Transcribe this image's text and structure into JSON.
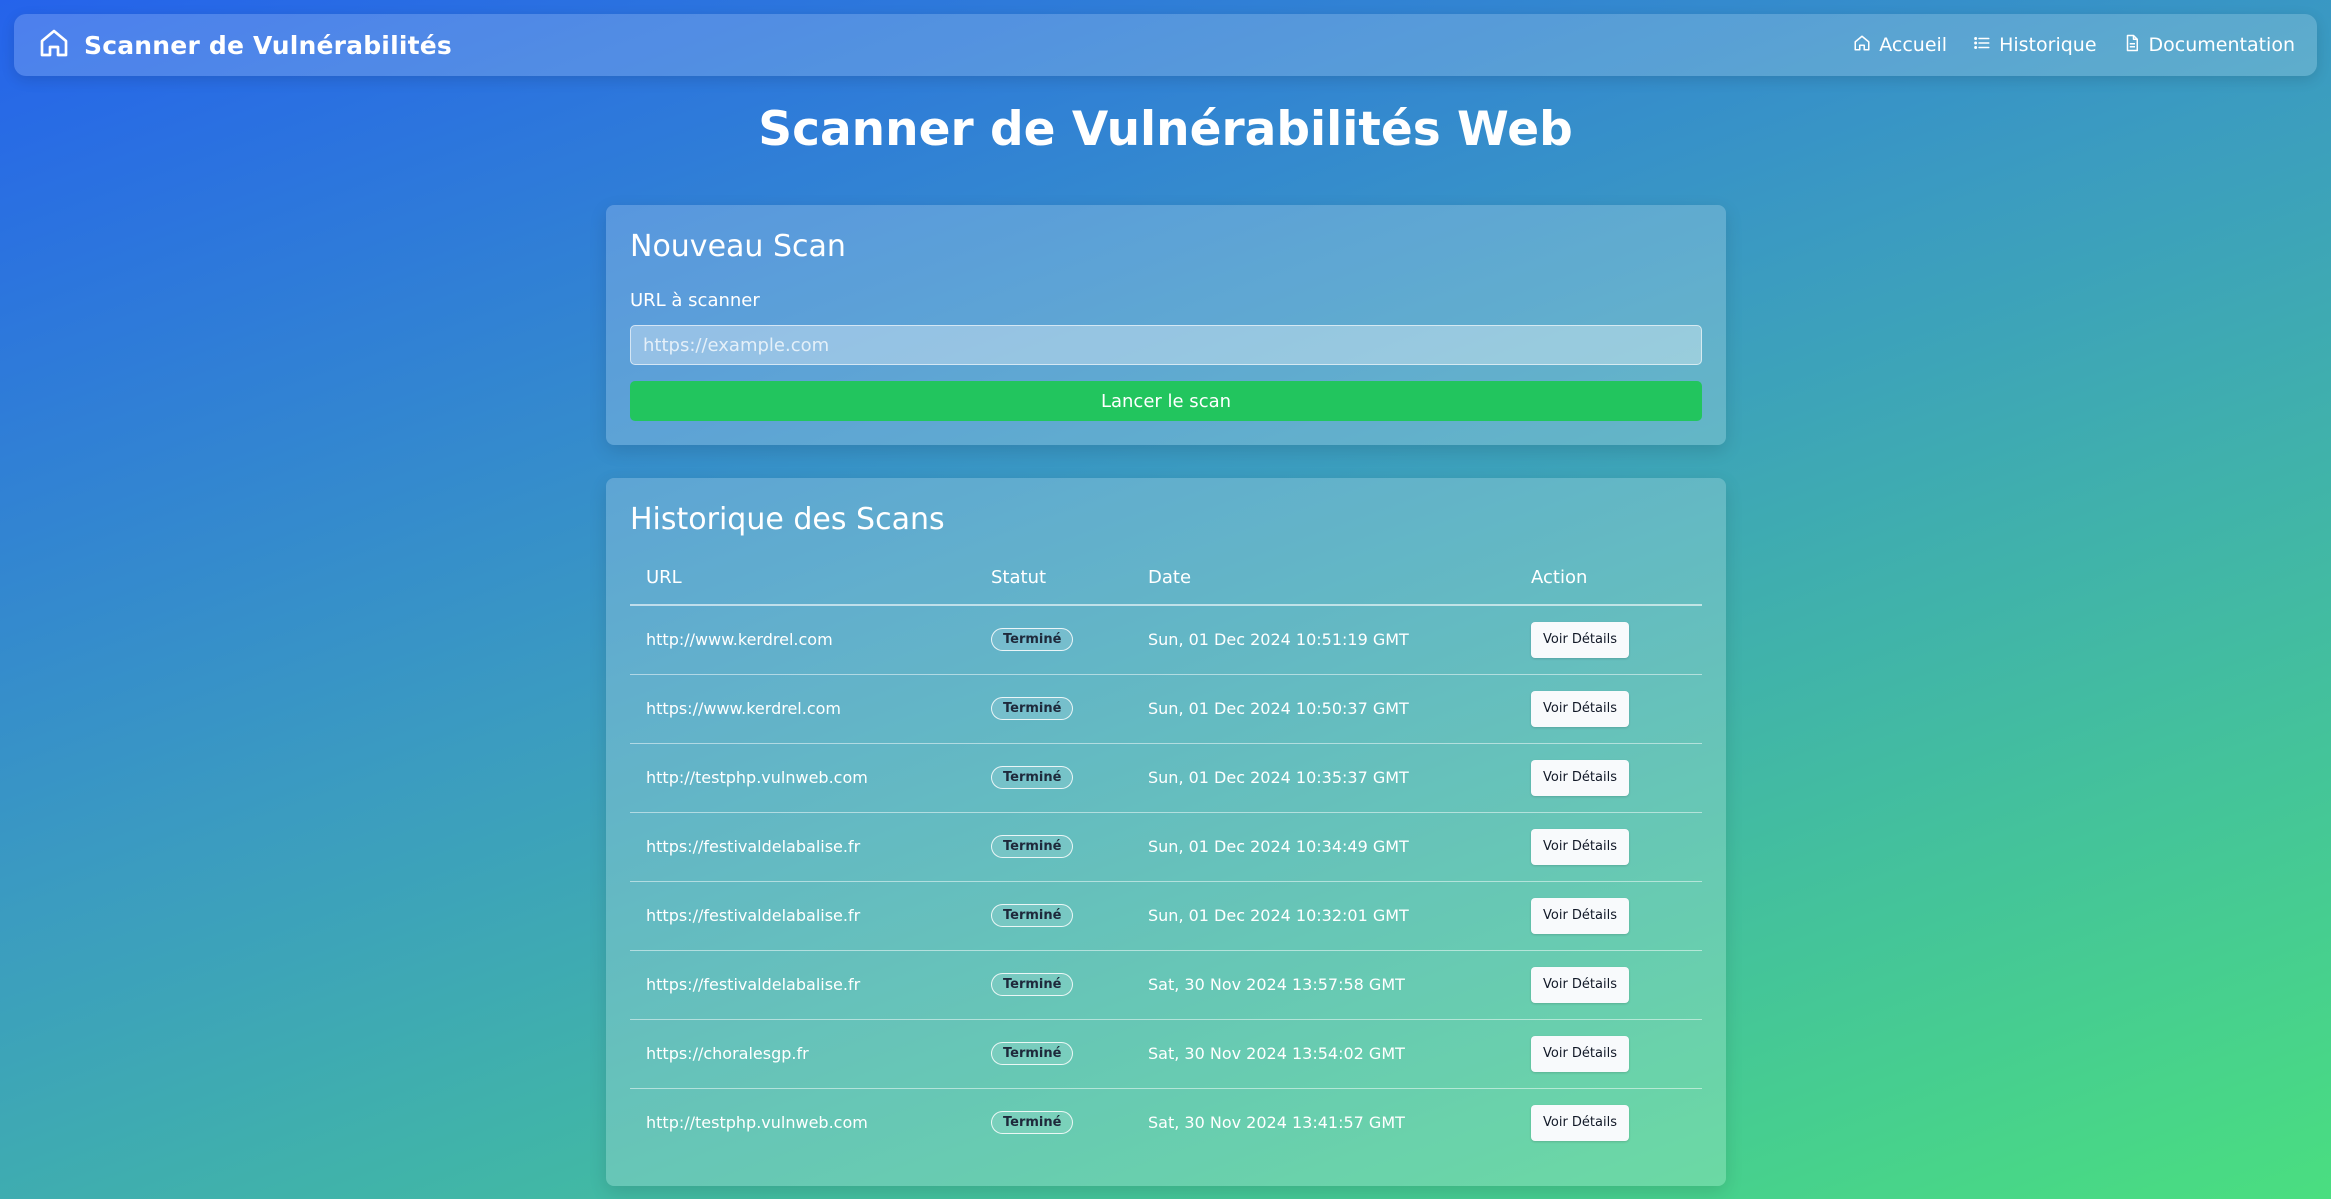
{
  "navbar": {
    "brand_title": "Scanner de Vulnérabilités",
    "brand_icon": "home-icon",
    "links": [
      {
        "label": "Accueil",
        "icon": "home-icon"
      },
      {
        "label": "Historique",
        "icon": "list-icon"
      },
      {
        "label": "Documentation",
        "icon": "document-icon"
      }
    ]
  },
  "page_title": "Scanner de Vulnérabilités Web",
  "scan_form": {
    "title": "Nouveau Scan",
    "url_label": "URL à scanner",
    "url_value": "",
    "url_placeholder": "https://example.com",
    "submit_label": "Lancer le scan",
    "submit_color": "#22c55e"
  },
  "history": {
    "title": "Historique des Scans",
    "columns": [
      "URL",
      "Statut",
      "Date",
      "Action"
    ],
    "rows": [
      {
        "url": "http://www.kerdrel.com",
        "status": "Terminé",
        "date": "Sun, 01 Dec 2024 10:51:19 GMT",
        "action": "Voir Détails"
      },
      {
        "url": "https://www.kerdrel.com",
        "status": "Terminé",
        "date": "Sun, 01 Dec 2024 10:50:37 GMT",
        "action": "Voir Détails"
      },
      {
        "url": "http://testphp.vulnweb.com",
        "status": "Terminé",
        "date": "Sun, 01 Dec 2024 10:35:37 GMT",
        "action": "Voir Détails"
      },
      {
        "url": "https://festivaldelabalise.fr",
        "status": "Terminé",
        "date": "Sun, 01 Dec 2024 10:34:49 GMT",
        "action": "Voir Détails"
      },
      {
        "url": "https://festivaldelabalise.fr",
        "status": "Terminé",
        "date": "Sun, 01 Dec 2024 10:32:01 GMT",
        "action": "Voir Détails"
      },
      {
        "url": "https://festivaldelabalise.fr",
        "status": "Terminé",
        "date": "Sat, 30 Nov 2024 13:57:58 GMT",
        "action": "Voir Détails"
      },
      {
        "url": "https://choralesgp.fr",
        "status": "Terminé",
        "date": "Sat, 30 Nov 2024 13:54:02 GMT",
        "action": "Voir Détails"
      },
      {
        "url": "http://testphp.vulnweb.com",
        "status": "Terminé",
        "date": "Sat, 30 Nov 2024 13:41:57 GMT",
        "action": "Voir Détails"
      }
    ]
  }
}
